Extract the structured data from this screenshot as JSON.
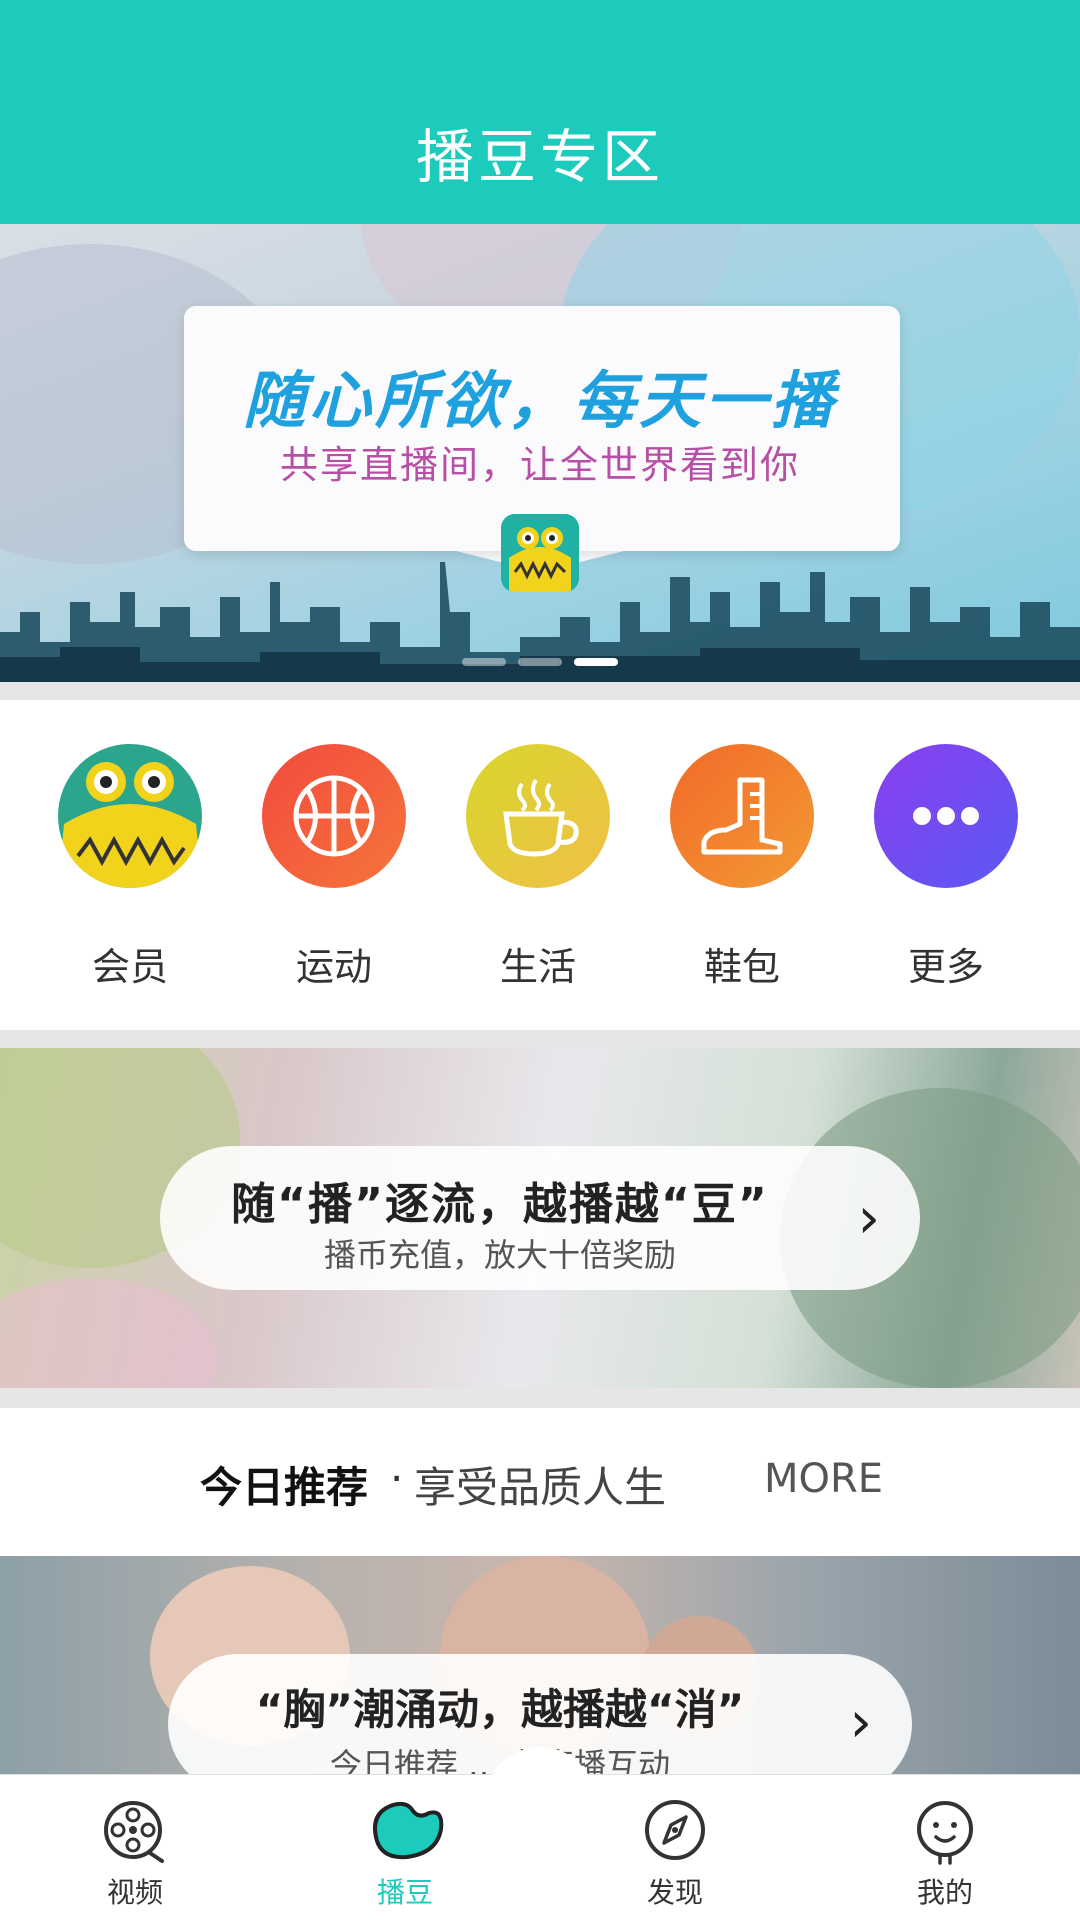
{
  "header": {
    "title": "播豆专区"
  },
  "banner": {
    "slogan": "随心所欲，每天一播",
    "subtitle": "共享直播间，让全世界看到你",
    "slides": 3,
    "active_slide": 3
  },
  "categories": [
    {
      "label": "会员",
      "icon": "monster-icon",
      "color": "#2ca58d"
    },
    {
      "label": "运动",
      "icon": "basketball-icon",
      "color": "#f4554a"
    },
    {
      "label": "生活",
      "icon": "coffee-cup-icon",
      "color": "#e0d23a"
    },
    {
      "label": "鞋包",
      "icon": "boot-icon",
      "color": "#f27d2b"
    },
    {
      "label": "更多",
      "icon": "more-icon",
      "color": "#7b4ff0"
    }
  ],
  "promo": {
    "title": "随“播”逐流，越播越“豆”",
    "subtitle": "播币充值，放大十倍奖励"
  },
  "recommend": {
    "title": "今日推荐",
    "separator": "·",
    "subtitle": "享受品质人生",
    "more": "MORE"
  },
  "feature": {
    "title": "“胸”潮涌动，越播越“消”",
    "subtitle": "今日推荐 … 友直播互动"
  },
  "tabs": [
    {
      "label": "视频",
      "icon": "film-reel-icon",
      "active": false
    },
    {
      "label": "播豆",
      "icon": "bean-icon",
      "active": true
    },
    {
      "label": "发现",
      "icon": "compass-icon",
      "active": false
    },
    {
      "label": "我的",
      "icon": "smiley-icon",
      "active": false
    }
  ],
  "colors": {
    "accent": "#1ccbbb"
  }
}
